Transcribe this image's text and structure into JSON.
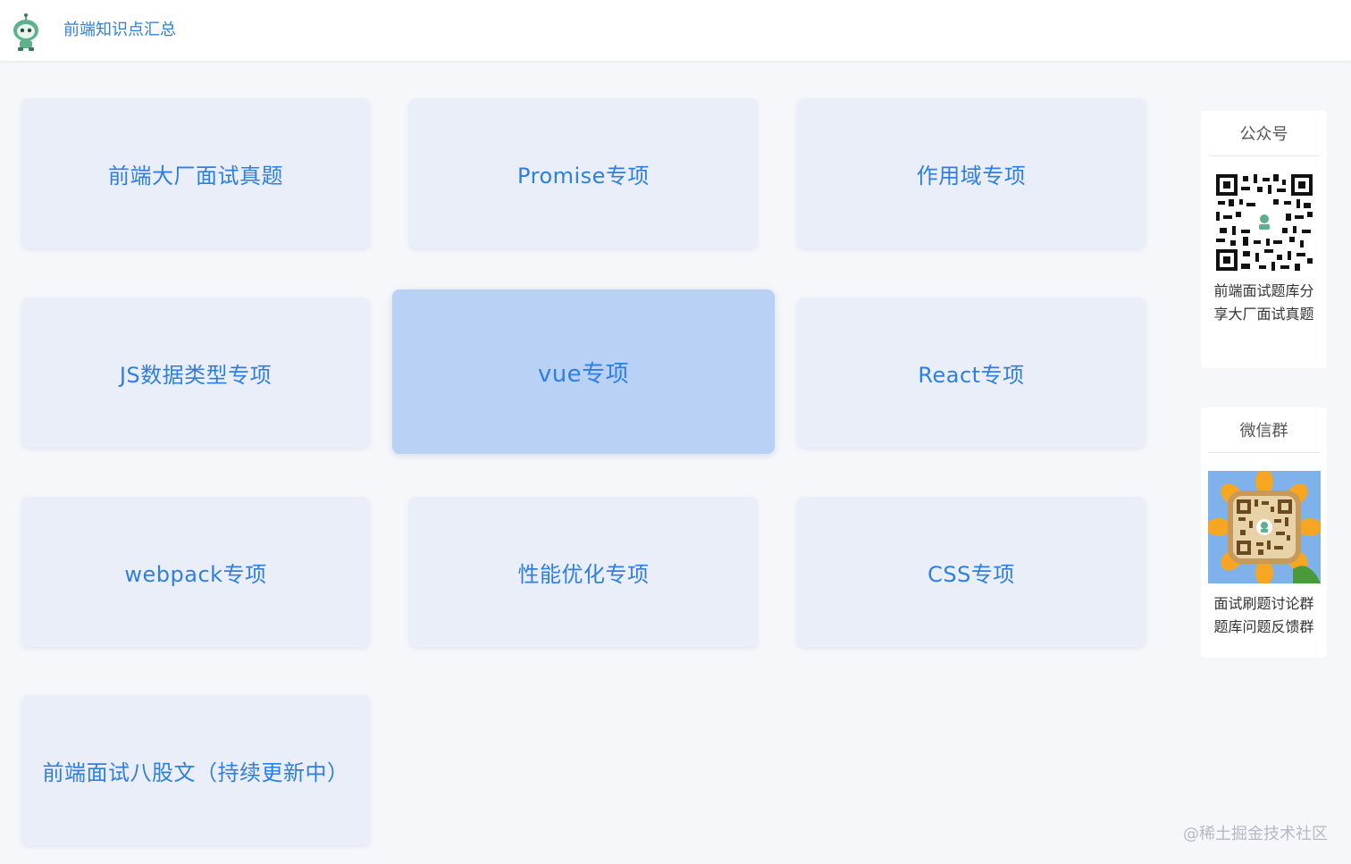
{
  "header": {
    "title": "前端知识点汇总",
    "logo_icon": "robot-mascot-icon"
  },
  "cards": [
    {
      "label": "前端大厂面试真题",
      "active": false
    },
    {
      "label": "Promise专项",
      "active": false
    },
    {
      "label": "作用域专项",
      "active": false
    },
    {
      "label": "JS数据类型专项",
      "active": false
    },
    {
      "label": "vue专项",
      "active": true
    },
    {
      "label": "React专项",
      "active": false
    },
    {
      "label": "webpack专项",
      "active": false
    },
    {
      "label": "性能优化专项",
      "active": false
    },
    {
      "label": "CSS专项",
      "active": false
    },
    {
      "label": "前端面试八股文（持续更新中）",
      "active": false
    }
  ],
  "sidebar": {
    "official_account": {
      "title": "公众号",
      "qr_icon": "qr-code-icon",
      "description": "前端面试题库分享大厂面试真题"
    },
    "wechat_group": {
      "title": "微信群",
      "qr_icon": "sunflower-qr-code-icon",
      "line1": "面试刷题讨论群",
      "line2": "题库问题反馈群"
    }
  },
  "watermark": "@稀土掘金技术社区",
  "colors": {
    "accent": "#2f7fe0",
    "card_bg": "#e9eef9",
    "card_active_bg": "#b8d1f5",
    "page_bg": "#f5f7fa"
  }
}
